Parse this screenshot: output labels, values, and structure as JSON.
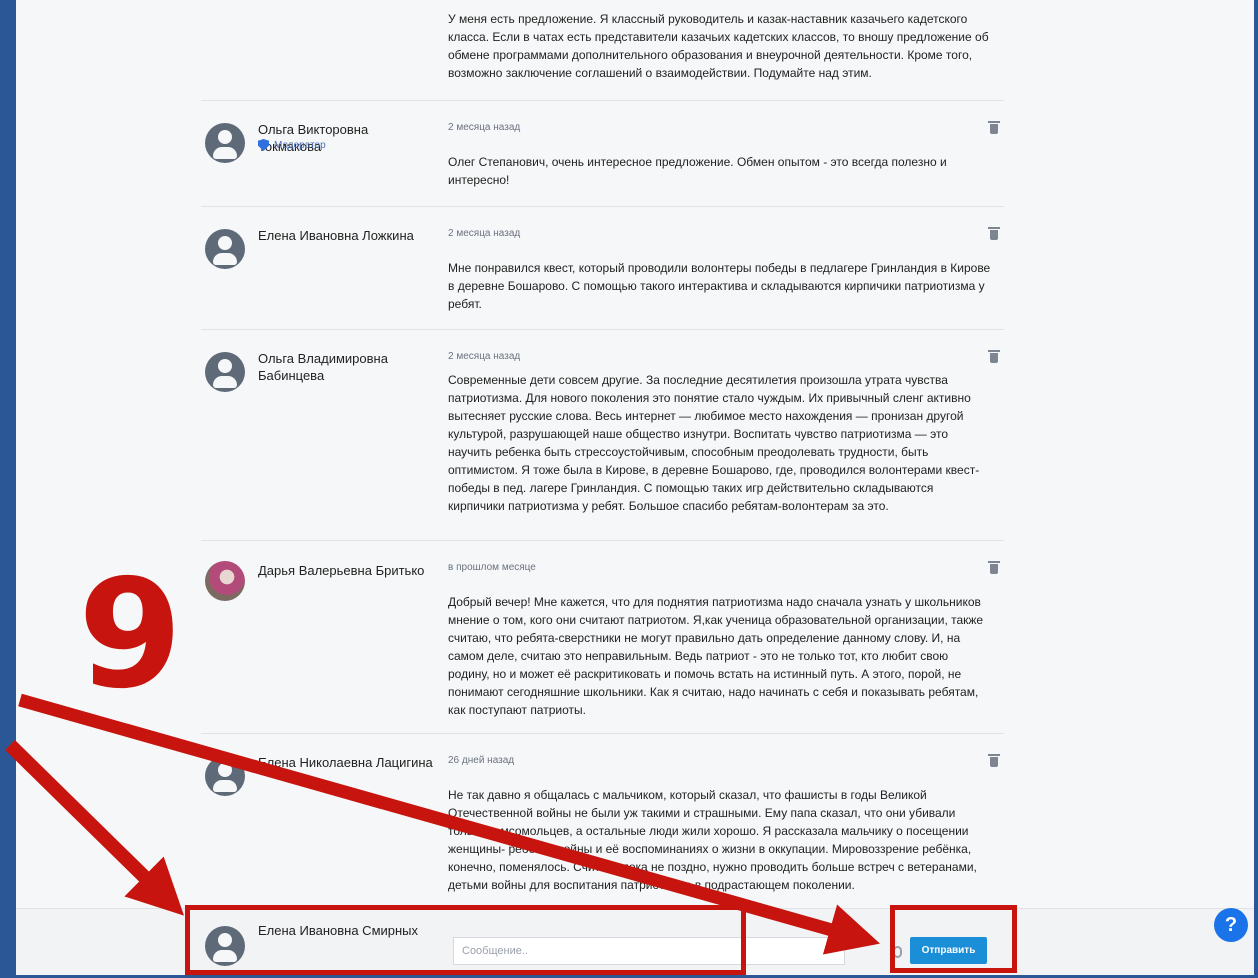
{
  "comments": [
    {
      "author": "",
      "time": "",
      "text": "У меня есть предложение. Я классный руководитель и казак-наставник казачьего кадетского класса. Если в чатах есть представители казачьих кадетских классов, то вношу предложение об обмене программами дополнительного образования и внеурочной деятельности. Кроме того, возможно заключение соглашений о взаимодействии. Подумайте над этим."
    },
    {
      "author": "Ольга Викторовна Токмакова",
      "role": "Модератор",
      "time": "2 месяца назад",
      "text": "Олег Степанович, очень интересное предложение. Обмен опытом - это всегда полезно и интересно!"
    },
    {
      "author": "Елена Ивановна Ложкина",
      "time": "2 месяца назад",
      "text": "Мне понравился квест, который проводили волонтеры победы в педлагере Гринландия в Кирове в деревне Бошарово. С помощью такого интерактива и складываются кирпичики патриотизма у ребят."
    },
    {
      "author": "Ольга Владимировна Бабинцева",
      "time": "2 месяца назад",
      "text": "Современные дети совсем другие. За последние десятилетия произошла утрата чувства патриотизма. Для нового поколения это понятие стало чуждым. Их привычный сленг активно вытесняет русские слова. Весь интернет — любимое место нахождения — пронизан другой культурой, разрушающей наше общество изнутри. Воспитать чувство патриотизма — это научить ребенка быть стрессоустойчивым, способным преодолевать трудности, быть оптимистом. Я тоже была в Кирове, в деревне Бошарово, где, проводился волонтерами квест-победы в пед. лагере Гринландия. С помощью таких игр действительно складываются кирпичики патриотизма у ребят. Большое спасибо ребятам-волонтерам за это."
    },
    {
      "author": "Дарья Валерьевна Бритько",
      "time": "в прошлом месяце",
      "text": "Добрый вечер! Мне кажется, что для поднятия патриотизма надо сначала узнать у школьников мнение о том, кого они считают патриотом. Я,как ученица образовательной организации, также считаю, что ребята-сверстники не могут правильно дать определение данному слову. И, на самом деле, считаю это неправильным. Ведь патриот - это не только тот, кто любит свою родину, но и может её раскритиковать и помочь встать на истинный путь. А этого, порой, не понимают сегодняшние школьники. Как я считаю, надо начинать с себя и показывать ребятам, как поступают патриоты."
    },
    {
      "author": "Елена Николаевна Лацигина",
      "time": "26 дней назад",
      "text": "Не так давно я общалась с мальчиком, который сказал, что фашисты в годы Великой Отечественной войны не были уж такими и страшными. Ему папа сказал, что они убивали только комсомольцев, а остальные люди жили хорошо. Я рассказала мальчику о посещении женщины- ребёнка войны и её воспоминаниях о жизни в оккупации. Мировоззрение ребёнка, конечно, поменялось. Считаю, пока не поздно, нужно проводить больше встреч с ветеранами, детьми войны для воспитания патриотизма в подрастающем поколении."
    }
  ],
  "composer": {
    "author": "Елена Ивановна Смирных",
    "placeholder": "Сообщение..",
    "send_label": "Отправить"
  },
  "help_glyph": "?",
  "annotation": {
    "number": "9",
    "color": "#c8140e"
  },
  "colors": {
    "frame_border": "#2b5797",
    "send_button": "#1a8fd8",
    "moderator_badge": "#2f6fe0"
  }
}
